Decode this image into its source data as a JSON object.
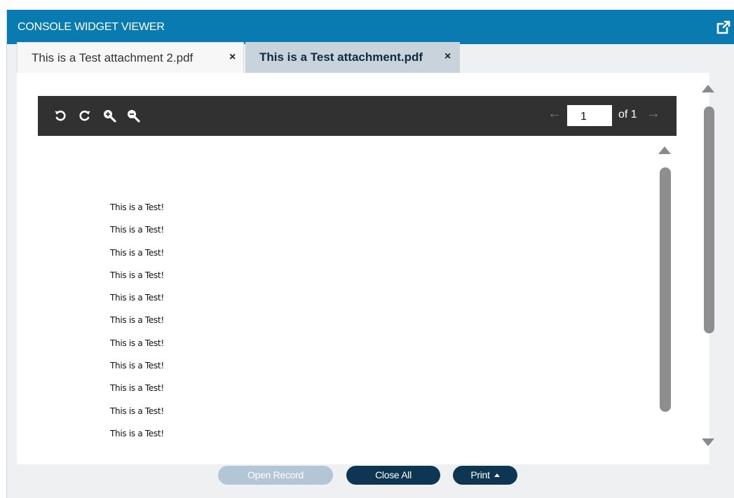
{
  "window": {
    "title": "CONSOLE WIDGET VIEWER",
    "popout_icon": "external-link-icon"
  },
  "tabs": [
    {
      "label": "This is a Test attachment 2.pdf",
      "close": "×",
      "active": false
    },
    {
      "label": "This is a Test attachment.pdf",
      "close": "×",
      "active": true
    }
  ],
  "toolbar": {
    "tools": [
      "rotate-left-icon",
      "rotate-right-icon",
      "zoom-in-icon",
      "zoom-out-icon"
    ],
    "prev_arrow": "←",
    "page_value": "1",
    "page_of": "of 1",
    "next_arrow": "→"
  },
  "document": {
    "lines": [
      "This is a Test!",
      "This is a Test!",
      "This is a Test!",
      "This is a Test!",
      "This is a Test!",
      "This is a Test!",
      "This is a Test!",
      "This is a Test!",
      "This is a Test!",
      "This is a Test!",
      "This is a Test!"
    ]
  },
  "footer": {
    "open_record": "Open Record",
    "close_all": "Close All",
    "print": "Print"
  },
  "colors": {
    "titlebar": "#0a7bb0",
    "active_tab": "#c9d3dc",
    "toolbar": "#313131",
    "button_primary": "#0e3652",
    "button_disabled": "#b3c6d5"
  }
}
